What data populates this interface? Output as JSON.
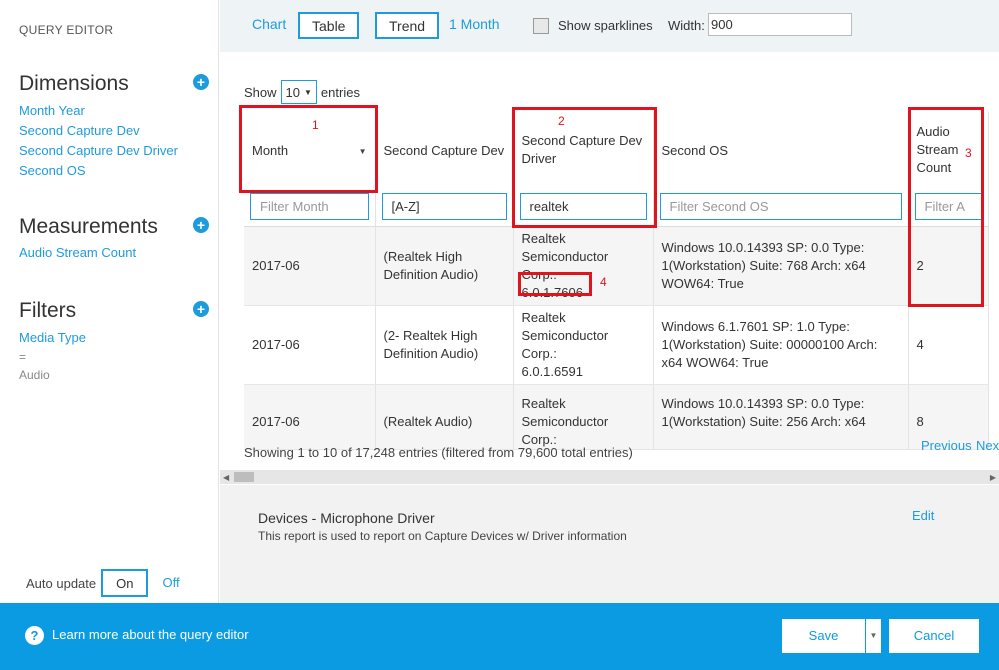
{
  "sidebar": {
    "title": "QUERY EDITOR",
    "dimensions": {
      "heading": "Dimensions",
      "items": [
        "Month Year",
        "Second Capture Dev",
        "Second Capture Dev Driver",
        "Second OS"
      ]
    },
    "measurements": {
      "heading": "Measurements",
      "items": [
        "Audio Stream Count"
      ]
    },
    "filters": {
      "heading": "Filters",
      "item": "Media Type",
      "operator": "=",
      "value": "Audio"
    },
    "auto_update": {
      "label": "Auto update",
      "on": "On",
      "off": "Off",
      "selected": "On"
    }
  },
  "toolbar": {
    "chart": "Chart",
    "table": "Table",
    "trend": "Trend",
    "period": "1 Month",
    "sparklines_label": "Show sparklines",
    "sparklines_checked": false,
    "width_label": "Width:",
    "width_value": "900"
  },
  "table": {
    "show_label": "Show",
    "entries_value": "10",
    "entries_label": "entries",
    "columns": [
      "Month",
      "Second Capture Dev",
      "Second Capture Dev Driver",
      "Second OS",
      "Audio Stream Count"
    ],
    "filters": [
      "Filter Month",
      "[A-Z]",
      "realtek",
      "Filter Second OS",
      "Filter A"
    ],
    "rows": [
      {
        "month": "2017-06",
        "device": "(Realtek High Definition Audio)",
        "driver_name": "Realtek Semiconductor Corp.:",
        "driver_version": "6.0.1.7606",
        "os": "Windows 10.0.14393 SP: 0.0 Type: 1(Workstation) Suite: 768 Arch: x64 WOW64: True",
        "count": "2"
      },
      {
        "month": "2017-06",
        "device": "(2- Realtek High Definition Audio)",
        "driver_name": "Realtek Semiconductor Corp.:",
        "driver_version": "6.0.1.6591",
        "os": "Windows 6.1.7601 SP: 1.0 Type: 1(Workstation) Suite: 00000100 Arch: x64 WOW64: True",
        "count": "4"
      },
      {
        "month": "2017-06",
        "device": "(Realtek Audio)",
        "driver_name": "Realtek Semiconductor Corp.:",
        "driver_version": "",
        "os": "Windows 10.0.14393 SP: 0.0 Type: 1(Workstation) Suite: 256 Arch: x64",
        "count": "8"
      }
    ],
    "summary": "Showing 1 to 10 of 17,248 entries (filtered from 79,600 total entries)",
    "previous": "Previous",
    "next": "Next"
  },
  "annotations": [
    "1",
    "2",
    "3",
    "4"
  ],
  "report": {
    "title": "Devices - Microphone Driver",
    "description": "This report is used to report on Capture Devices w/ Driver information",
    "edit": "Edit"
  },
  "footer": {
    "help_text": "Learn more about the query editor",
    "save": "Save",
    "cancel": "Cancel"
  },
  "colors": {
    "accent": "#1e9bdc",
    "footer": "#0b9be2",
    "annotation": "#e0141e"
  }
}
